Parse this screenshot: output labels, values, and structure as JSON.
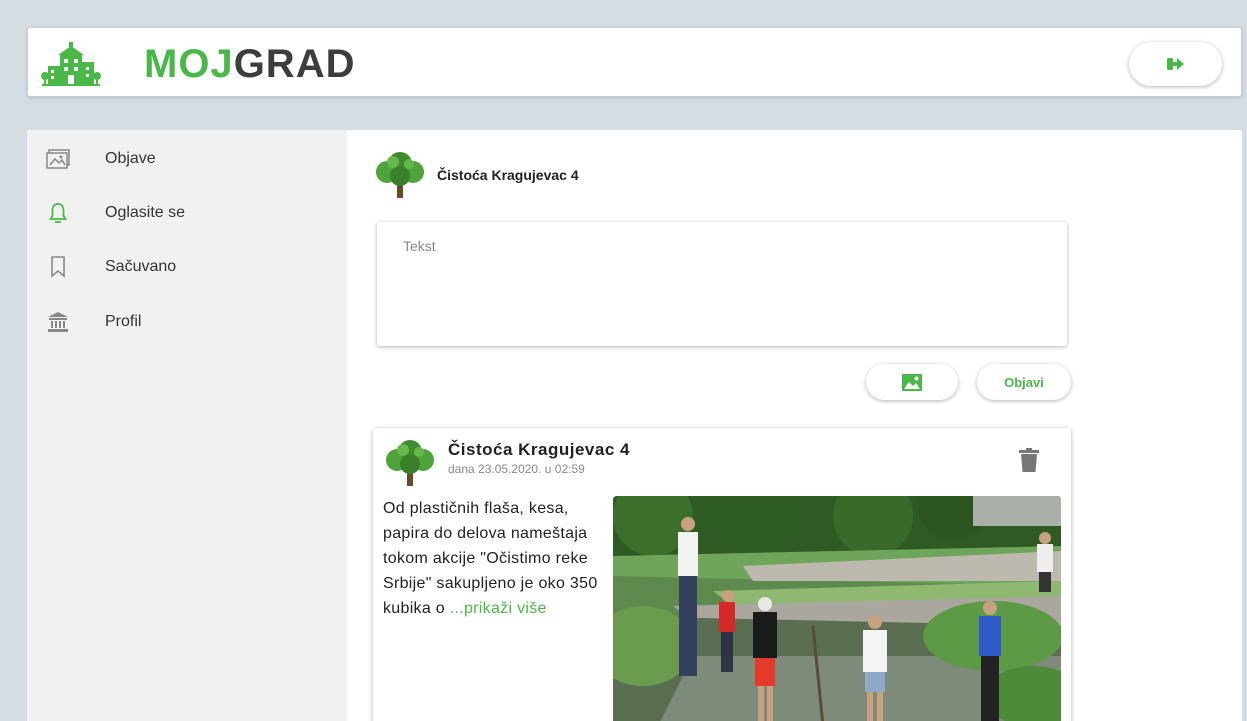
{
  "header": {
    "logo_part1": "MOJ",
    "logo_part2": "GRAD",
    "logout_icon": "sign-out-icon"
  },
  "sidebar": {
    "items": [
      {
        "label": "Objave",
        "icon": "posts-icon"
      },
      {
        "label": "Oglasite se",
        "icon": "bell-icon",
        "active": true
      },
      {
        "label": "Sačuvano",
        "icon": "bookmark-icon"
      },
      {
        "label": "Profil",
        "icon": "institution-icon"
      }
    ]
  },
  "composer": {
    "user_name": "Čistoća Kragujevac 4",
    "placeholder": "Tekst",
    "image_button_icon": "image-icon",
    "post_button_label": "Objavi"
  },
  "post": {
    "author": "Čistoća Kragujevac 4",
    "date": "dana 23.05.2020. u 02:59",
    "text": "Od plastičnih flaša, kesa, papira do delova nameštaja tokom akcije \"Očistimo reke Srbije\" sakupljeno je oko 350 kubika o ",
    "more_label": "...prikaži više",
    "delete_icon": "trash-icon"
  },
  "colors": {
    "brand_green": "#4ab848",
    "brand_dark": "#3d3d3d",
    "sidebar_bg": "#f1f1f1"
  }
}
